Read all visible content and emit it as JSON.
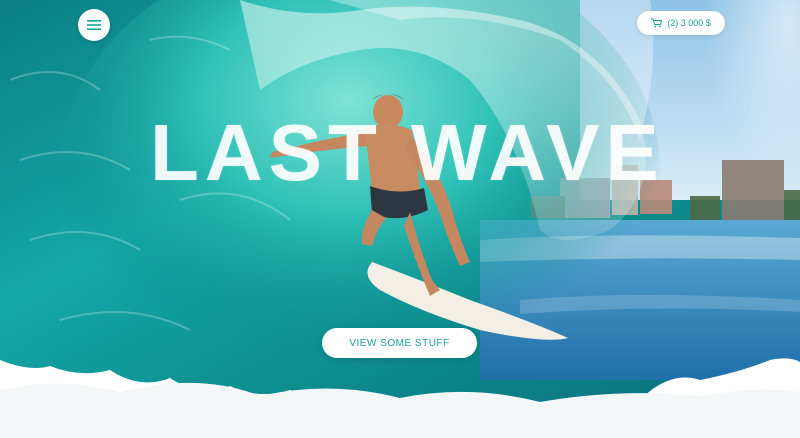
{
  "header": {
    "menu_icon": "hamburger-menu-icon",
    "cart": {
      "icon": "shopping-cart-icon",
      "label": "(2) 3 000 $"
    }
  },
  "hero": {
    "headline": "LAST WAVE",
    "cta_label": "VIEW SOME STUFF"
  },
  "colors": {
    "accent": "#1aa39a",
    "button_bg": "#ffffff",
    "sea_dark": "#0a6f73",
    "sea_light": "#37c3bd",
    "sky": "#a9d3ee"
  }
}
